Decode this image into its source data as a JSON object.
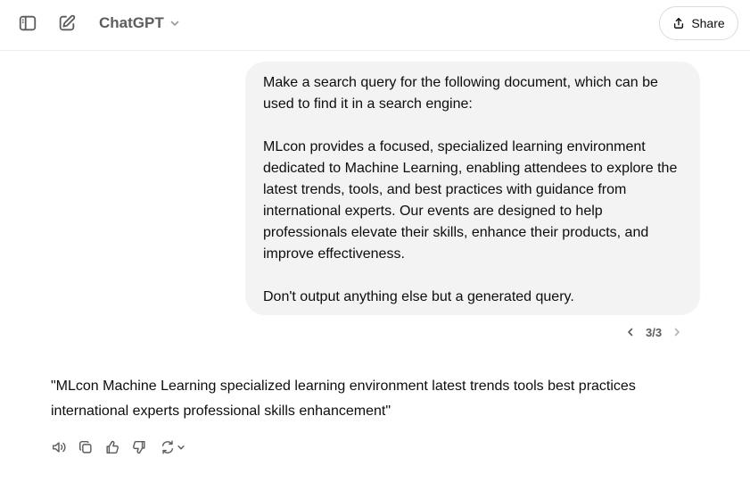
{
  "header": {
    "model_name": "ChatGPT",
    "share_label": "Share"
  },
  "icons": {
    "sidebar": "sidebar-toggle-icon",
    "new_chat": "new-chat-icon",
    "model_dropdown": "chevron-down-icon",
    "share": "share-icon",
    "prev": "chevron-left-icon",
    "next": "chevron-right-icon",
    "read_aloud": "speaker-icon",
    "copy": "copy-icon",
    "like": "thumbs-up-icon",
    "dislike": "thumbs-down-icon",
    "regenerate": "regenerate-icon"
  },
  "conversation": {
    "user_message": {
      "paragraphs": [
        "Make a search query for the following document, which can be used to find it in a search engine:",
        "MLcon provides a focused, specialized learning environment dedicated to Machine Learning, enabling attendees to explore the latest trends, tools, and best practices with guidance from international experts. Our events are designed to help professionals elevate their skills, enhance their products, and improve effectiveness.",
        "Don't output anything else but a generated query."
      ],
      "version_pager": "3/3"
    },
    "assistant_message": "\"MLcon Machine Learning specialized learning environment latest trends tools best practices international experts professional skills enhancement\""
  },
  "colors": {
    "text": "#0d0d0d",
    "muted": "#5d5d5d",
    "bubble": "#f3f3f3",
    "divider": "#ececec"
  }
}
